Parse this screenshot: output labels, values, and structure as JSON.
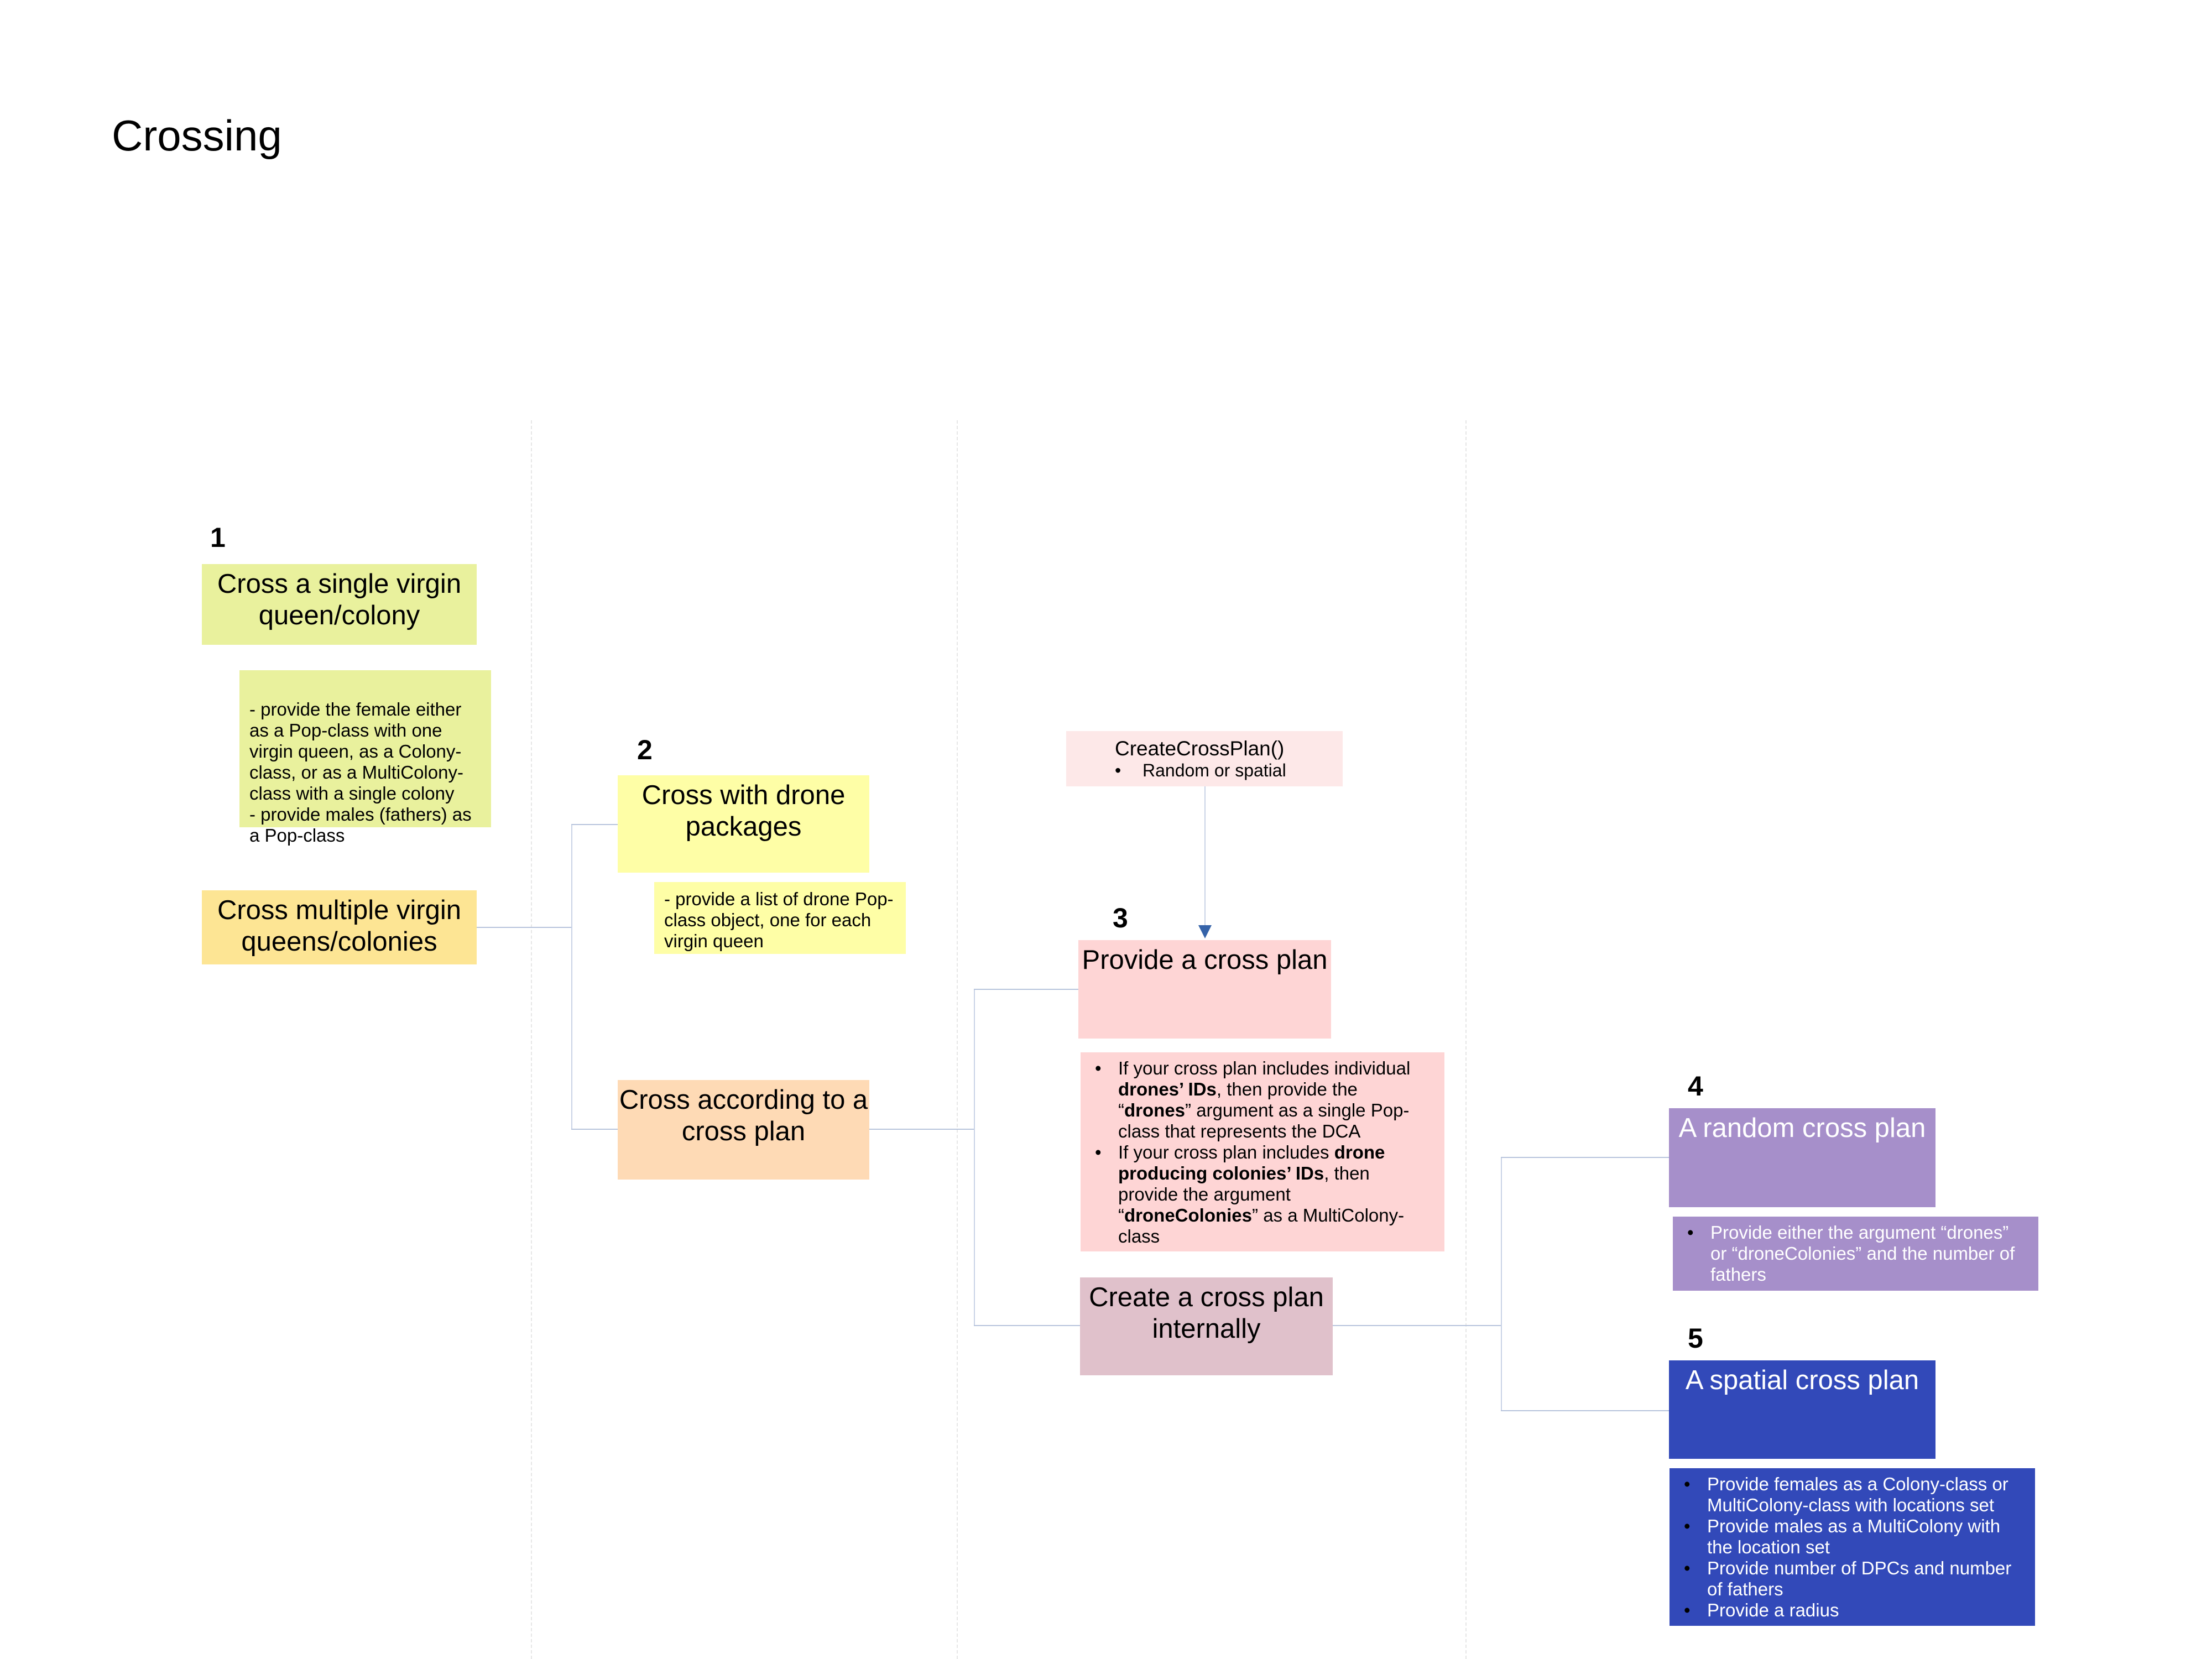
{
  "title": "Crossing",
  "steps": {
    "s1": {
      "number": "1",
      "label": "Cross a single virgin queen/colony",
      "note": "- provide the female either as a Pop-class with one virgin queen, as a Colony-class, or as a MultiColony-class with a single colony\n- provide males (fathers) as a Pop-class"
    },
    "multi": {
      "label": "Cross multiple virgin queens/colonies"
    },
    "s2": {
      "number": "2",
      "label": "Cross with drone packages",
      "note": "- provide a list of drone Pop-class object, one for each virgin queen"
    },
    "plan": {
      "label": "Cross according to a cross plan"
    },
    "create_fn": {
      "label": "CreateCrossPlan()",
      "bullet": "Random or spatial"
    },
    "s3": {
      "number": "3",
      "label": "Provide a cross plan",
      "bullets": [
        {
          "t1": "If your cross plan includes individual ",
          "b1": "drones’ IDs",
          "t2": ", then provide the “",
          "b2": "drones",
          "t3": "” argument as a single Pop-class that represents the DCA"
        },
        {
          "t1": "If your cross plan includes ",
          "b1": "drone producing colonies’ IDs",
          "t2": ", then provide the argument “",
          "b2": "droneColonies",
          "t3": "” as a MultiColony-class"
        }
      ]
    },
    "internal": {
      "label": "Create a cross plan internally"
    },
    "s4": {
      "number": "4",
      "label": "A random cross plan",
      "bullets": [
        "Provide either the argument “drones” or “droneColonies” and the number of fathers"
      ]
    },
    "s5": {
      "number": "5",
      "label": "A spatial cross plan",
      "bullets": [
        "Provide females as a Colony-class or MultiColony-class with locations set",
        "Provide males as a MultiColony with the location set",
        "Provide number of DPCs and number of fathers",
        "Provide a radius"
      ]
    }
  },
  "colors": {
    "step1": "#e9f19d",
    "multi": "#fde594",
    "step2": "#fefea6",
    "plan": "#fedab5",
    "create_fn": "#fde8e8",
    "step3": "#fed5d5",
    "internal": "#e0c1cb",
    "step4": "#a68fca",
    "step5": "#3249b9",
    "connector": "#b7c4dc",
    "arrow": "#3563a9"
  }
}
